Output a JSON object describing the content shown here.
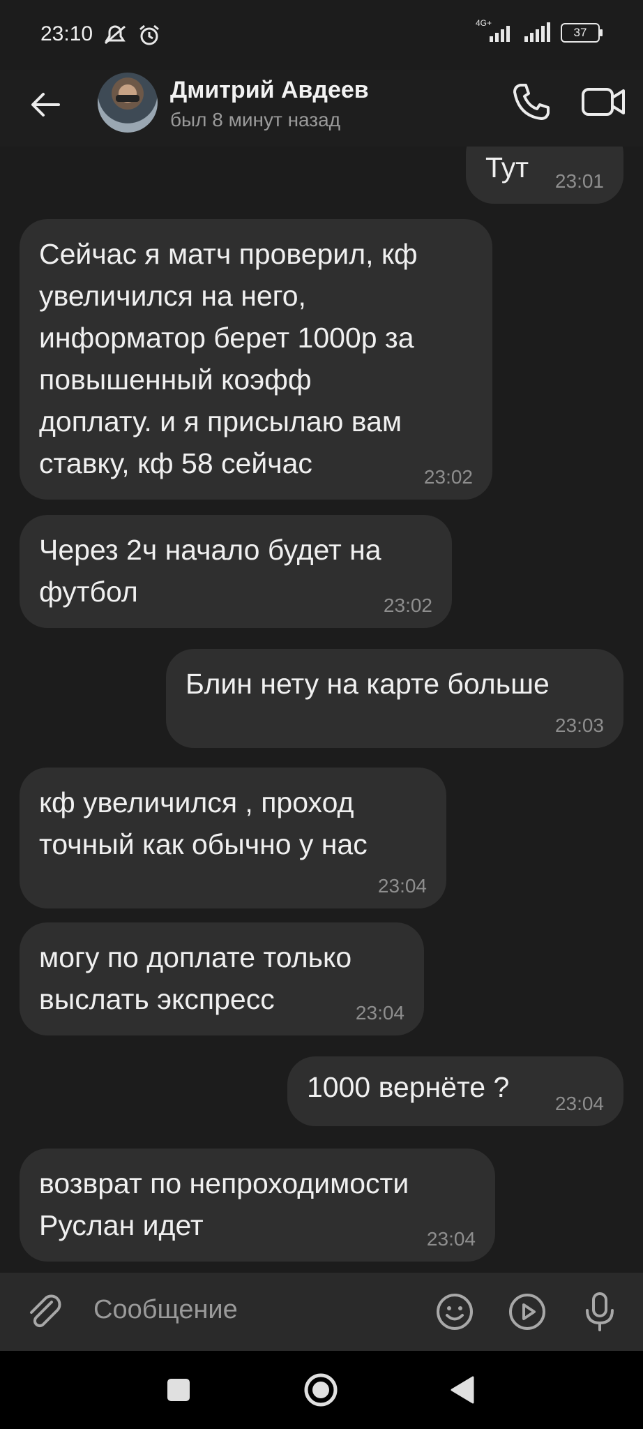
{
  "status_bar": {
    "time": "23:10",
    "network_label": "4G+",
    "battery_level": "37"
  },
  "header": {
    "contact_name": "Дмитрий Авдеев",
    "contact_status": "был 8 минут назад"
  },
  "messages": [
    {
      "direction": "outgoing",
      "text": "Тут",
      "time": "23:01"
    },
    {
      "direction": "incoming",
      "text": "Сейчас я матч проверил, кф\nувеличился на него,\nинформатор берет 1000р за\nповышенный коэфф\nдоплату. и я присылаю вам\nставку, кф 58 сейчас",
      "time": "23:02"
    },
    {
      "direction": "incoming",
      "text": "Через 2ч начало будет на\nфутбол",
      "time": "23:02"
    },
    {
      "direction": "outgoing",
      "text": "Блин нету на карте больше",
      "time": "23:03"
    },
    {
      "direction": "incoming",
      "text": "кф увеличился , проход\nточный как обычно у нас",
      "time": "23:04"
    },
    {
      "direction": "incoming",
      "text": "могу по доплате только\nвыслать экспресс",
      "time": "23:04"
    },
    {
      "direction": "outgoing",
      "text": "1000 вернёте ?",
      "time": "23:04"
    },
    {
      "direction": "incoming",
      "text": "возврат по непроходимости\nРуслан идет",
      "time": "23:04"
    }
  ],
  "composer": {
    "placeholder": "Сообщение"
  },
  "icons": {
    "back": "arrow-left-icon",
    "call": "phone-icon",
    "video": "video-camera-icon",
    "attach": "paperclip-icon",
    "emoji": "smiley-icon",
    "video_message": "play-circle-icon",
    "mic": "microphone-icon",
    "nav_recents": "square-icon",
    "nav_home": "circle-icon",
    "nav_back": "triangle-back-icon"
  }
}
